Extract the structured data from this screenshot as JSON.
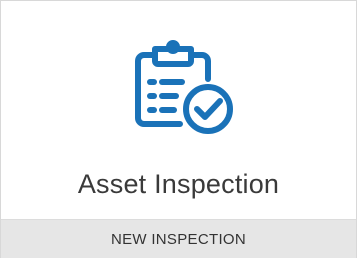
{
  "card": {
    "title": "Asset Inspection",
    "action_label": "NEW INSPECTION",
    "icon": "clipboard-check-icon",
    "accent_color": "#1a72b8"
  }
}
